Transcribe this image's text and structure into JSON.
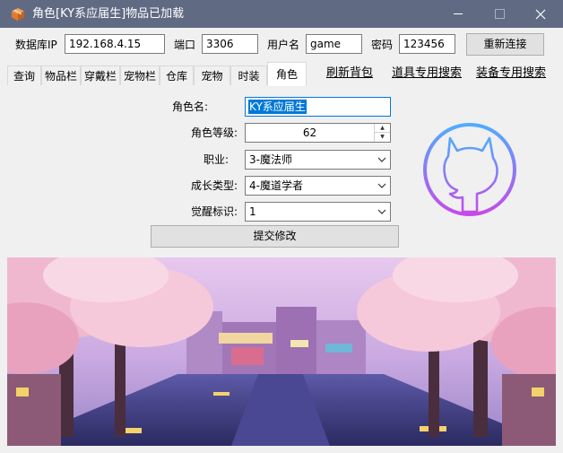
{
  "window": {
    "title": "角色[KY系应届生]物品已加载"
  },
  "connection": {
    "db_ip_label": "数据库IP",
    "db_ip_value": "192.168.4.15",
    "port_label": "端口",
    "port_value": "3306",
    "user_label": "用户名",
    "user_value": "game",
    "password_label": "密码",
    "password_value": "123456",
    "reconnect_label": "重新连接"
  },
  "tabs": [
    {
      "label": "查询"
    },
    {
      "label": "物品栏"
    },
    {
      "label": "穿戴栏"
    },
    {
      "label": "宠物栏"
    },
    {
      "label": "仓库"
    },
    {
      "label": "宠物"
    },
    {
      "label": "时装"
    },
    {
      "label": "角色",
      "active": true
    }
  ],
  "links": {
    "refresh_bag": "刷新背包",
    "item_search": "道具专用搜索",
    "equip_search": "装备专用搜索"
  },
  "role_form": {
    "name_label": "角色名:",
    "name_value": "KY系应届生",
    "level_label": "角色等级:",
    "level_value": "62",
    "job_label": "职业:",
    "job_value": "3-魔法师",
    "growth_label": "成长类型:",
    "growth_value": "4-魔道学者",
    "awaken_label": "觉醒标识:",
    "awaken_value": "1",
    "submit_label": "提交修改"
  },
  "icons": {
    "app": "package-icon",
    "logo": "github-octocat-icon",
    "dropdown": "chevron-down-icon"
  },
  "colors": {
    "titlebar": "#606b83",
    "selection": "#0078d7",
    "logo_gradient_start": "#4facfe",
    "logo_gradient_end": "#c54bea"
  }
}
